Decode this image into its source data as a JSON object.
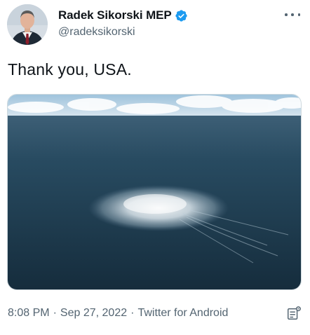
{
  "author": {
    "display_name": "Radek Sikorski MEP",
    "handle": "@radeksikorski",
    "verified": true
  },
  "tweet": {
    "text": "Thank you, USA.",
    "time": "8:08 PM",
    "separator": "·",
    "date": "Sep 27, 2022",
    "source": "Twitter for Android"
  },
  "icons": {
    "more": "more-horizontal-icon",
    "verified": "verified-badge-icon",
    "analytics": "tweet-analytics-icon"
  },
  "colors": {
    "text": "#0f1419",
    "secondary": "#536471",
    "verified": "#1d9bf0",
    "sea": "#1f3a4d"
  }
}
